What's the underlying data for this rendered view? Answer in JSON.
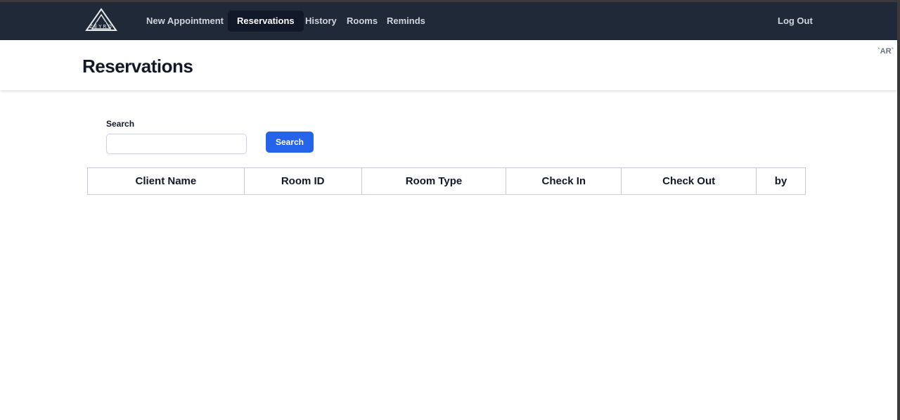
{
  "brand": {
    "logo_text": "ZEYRO"
  },
  "nav": {
    "items": [
      {
        "label": "New Appointment",
        "active": false
      },
      {
        "label": "Reservations",
        "active": true
      },
      {
        "label": "History",
        "active": false
      },
      {
        "label": "Rooms",
        "active": false
      },
      {
        "label": "Reminds",
        "active": false
      }
    ],
    "logout_label": "Log Out"
  },
  "header": {
    "title": "Reservations",
    "language_toggle": "`AR`"
  },
  "search": {
    "label": "Search",
    "value": "",
    "button_label": "Search"
  },
  "table": {
    "columns": [
      "Client Name",
      "Room ID",
      "Room Type",
      "Check In",
      "Check Out",
      "by"
    ],
    "rows": []
  },
  "colors": {
    "navbar_bg": "#1f2937",
    "active_tab_bg": "#111827",
    "primary_button": "#2563eb"
  }
}
